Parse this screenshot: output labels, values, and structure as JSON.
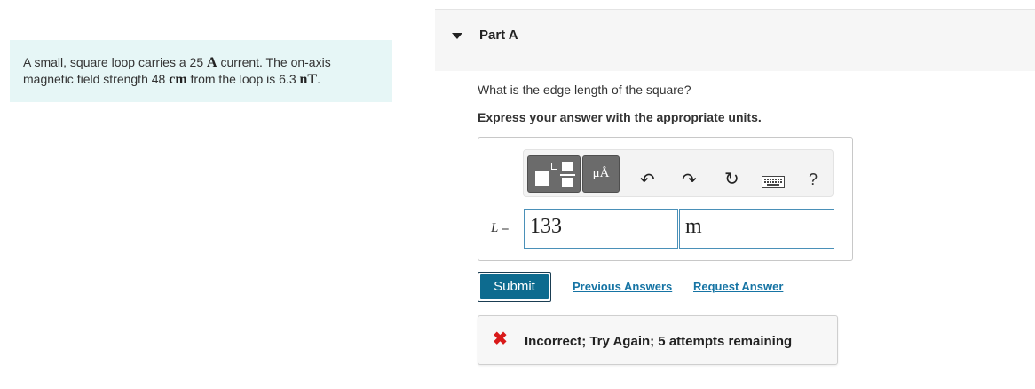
{
  "problem": {
    "part1": "A small, square loop carries a 25",
    "unit_current": "A",
    "part2": "current. The on-axis",
    "part3": "magnetic field strength 48",
    "unit_distance": "cm",
    "part4": "from the loop is 6.3",
    "unit_field": "nT",
    "part5": "."
  },
  "part": {
    "title": "Part A",
    "question": "What is the edge length of the square?",
    "instruction": "Express your answer with the appropriate units."
  },
  "toolbar": {
    "units_glyph": "μÅ",
    "undo_glyph": "↶",
    "redo_glyph": "↷",
    "reset_glyph": "↻",
    "help_glyph": "?",
    "icons": [
      "templates-icon",
      "units-icon",
      "undo-icon",
      "redo-icon",
      "reset-icon",
      "keyboard-icon",
      "help-icon"
    ]
  },
  "answer": {
    "variable": "L",
    "equals": "=",
    "value": "133",
    "units": "m"
  },
  "actions": {
    "submit": "Submit",
    "previous_answers": "Previous Answers",
    "request_answer": "Request Answer"
  },
  "feedback": {
    "icon": "✖",
    "text": "Incorrect; Try Again; 5 attempts remaining"
  },
  "colors": {
    "problem_bg": "#e6f6f6",
    "submit_bg": "#0d6b8f",
    "link": "#1674a4",
    "error": "#d91a1a",
    "input_border": "#4a90b8"
  }
}
